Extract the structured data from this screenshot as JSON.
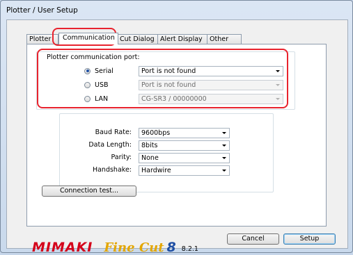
{
  "window": {
    "title": "Plotter / User Setup"
  },
  "tabs": [
    {
      "label": "Plotter"
    },
    {
      "label": "Communication"
    },
    {
      "label": "Cut Dialog"
    },
    {
      "label": "Alert Display"
    },
    {
      "label": "Other"
    }
  ],
  "comm_port": {
    "group_label": "Plotter communication port:",
    "serial": {
      "label": "Serial",
      "value": "Port is not found",
      "selected": true
    },
    "usb": {
      "label": "USB",
      "value": "Port is not found",
      "enabled": false
    },
    "lan": {
      "label": "LAN",
      "value": "CG-SR3 / 00000000",
      "enabled": false
    }
  },
  "serial_settings": {
    "baud_rate": {
      "label": "Baud Rate:",
      "value": "9600bps"
    },
    "data_length": {
      "label": "Data Length:",
      "value": "8bits"
    },
    "parity": {
      "label": "Parity:",
      "value": "None"
    },
    "handshake": {
      "label": "Handshake:",
      "value": "Hardwire"
    }
  },
  "buttons": {
    "connection_test": "Connection test...",
    "cancel": "Cancel",
    "setup": "Setup"
  },
  "branding": {
    "logo_text": "MIMAKI FineCut 8",
    "version": "8.2.1"
  },
  "colors": {
    "highlight": "#e8232e",
    "mimaki_red": "#d4001a",
    "finecut_gold": "#e3a600",
    "finecut_blue": "#1f4fa4"
  }
}
